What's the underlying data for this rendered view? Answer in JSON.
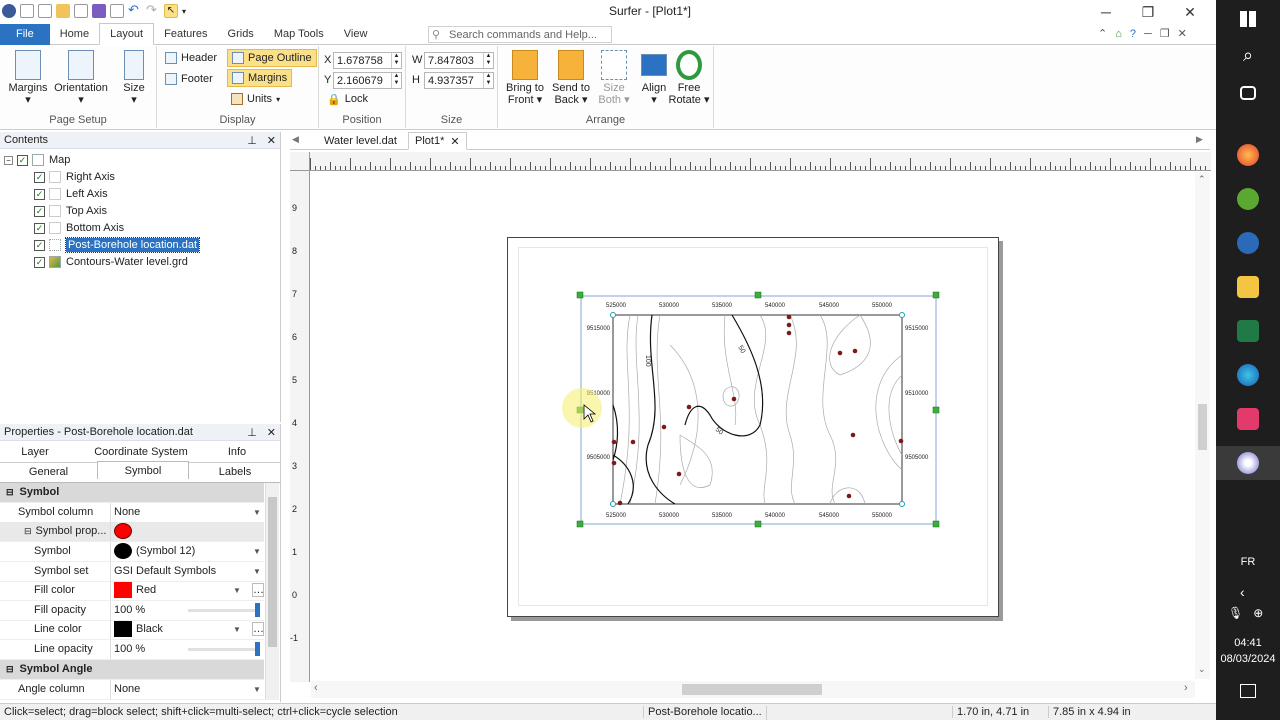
{
  "app": {
    "title": "Surfer - [Plot1*]"
  },
  "tabs": [
    "File",
    "Home",
    "Layout",
    "Features",
    "Grids",
    "Map Tools",
    "View"
  ],
  "search": {
    "placeholder": "Search commands and Help..."
  },
  "ribbon": {
    "page_setup": {
      "label": "Page Setup",
      "margins": "Margins",
      "orientation": "Orientation",
      "size": "Size"
    },
    "display": {
      "label": "Display",
      "header": "Header",
      "footer": "Footer",
      "page_outline": "Page Outline",
      "margins": "Margins",
      "units": "Units"
    },
    "position": {
      "label": "Position",
      "x_label": "X",
      "x": "1.678758",
      "y_label": "Y",
      "y": "2.160679",
      "lock": "Lock"
    },
    "size": {
      "label": "Size",
      "w_label": "W",
      "w": "7.847803",
      "h_label": "H",
      "h": "4.937357"
    },
    "arrange": {
      "label": "Arrange",
      "bring_front_1": "Bring to",
      "bring_front_2": "Front",
      "send_back_1": "Send to",
      "send_back_2": "Back",
      "size_both_1": "Size",
      "size_both_2": "Both",
      "align": "Align",
      "free_rotate_1": "Free",
      "free_rotate_2": "Rotate"
    }
  },
  "contents": {
    "title": "Contents",
    "items": [
      {
        "label": "Map",
        "level": 0
      },
      {
        "label": "Right Axis",
        "level": 1
      },
      {
        "label": "Left Axis",
        "level": 1
      },
      {
        "label": "Top Axis",
        "level": 1
      },
      {
        "label": "Bottom Axis",
        "level": 1
      },
      {
        "label": "Post-Borehole location.dat",
        "level": 1
      },
      {
        "label": "Contours-Water level.grd",
        "level": 1
      }
    ]
  },
  "properties": {
    "title": "Properties - Post-Borehole location.dat",
    "tabs_row1": [
      "Layer",
      "Coordinate System",
      "Info"
    ],
    "tabs_row2": [
      "General",
      "Symbol",
      "Labels"
    ],
    "rows": [
      {
        "k": "Symbol",
        "v": ""
      },
      {
        "k": "Symbol column",
        "v": "None"
      },
      {
        "k": "Symbol prop...",
        "v": ""
      },
      {
        "k": "Symbol",
        "v": "(Symbol 12)"
      },
      {
        "k": "Symbol set",
        "v": "GSI Default Symbols"
      },
      {
        "k": "Fill color",
        "v": "Red"
      },
      {
        "k": "Fill opacity",
        "v": "100 %"
      },
      {
        "k": "Line color",
        "v": "Black"
      },
      {
        "k": "Line opacity",
        "v": "100 %"
      },
      {
        "k": "Symbol Angle",
        "v": ""
      },
      {
        "k": "Angle column",
        "v": "None"
      }
    ],
    "fill_color": "#ff0000",
    "line_color": "#000000"
  },
  "doc_tabs": [
    "Water level.dat",
    "Plot1*"
  ],
  "ruler_v": [
    "9",
    "8",
    "7",
    "6",
    "5",
    "4",
    "3",
    "2",
    "1",
    "0",
    "-1"
  ],
  "map": {
    "x_ticks": [
      "525000",
      "530000",
      "535000",
      "540000",
      "545000",
      "550000"
    ],
    "y_ticks": [
      "9515000",
      "9510000",
      "9505000"
    ],
    "contour_labels": [
      "100",
      "50",
      "50"
    ]
  },
  "status": {
    "hint": "Click=select; drag=block select; shift+click=multi-select; ctrl+click=cycle selection",
    "selected": "Post-Borehole locatio...",
    "pos": "1.70 in, 4.71 in",
    "size": "7.85 in x 4.94 in"
  },
  "taskbar": {
    "lang": "FR",
    "time": "04:41",
    "date": "08/03/2024"
  }
}
